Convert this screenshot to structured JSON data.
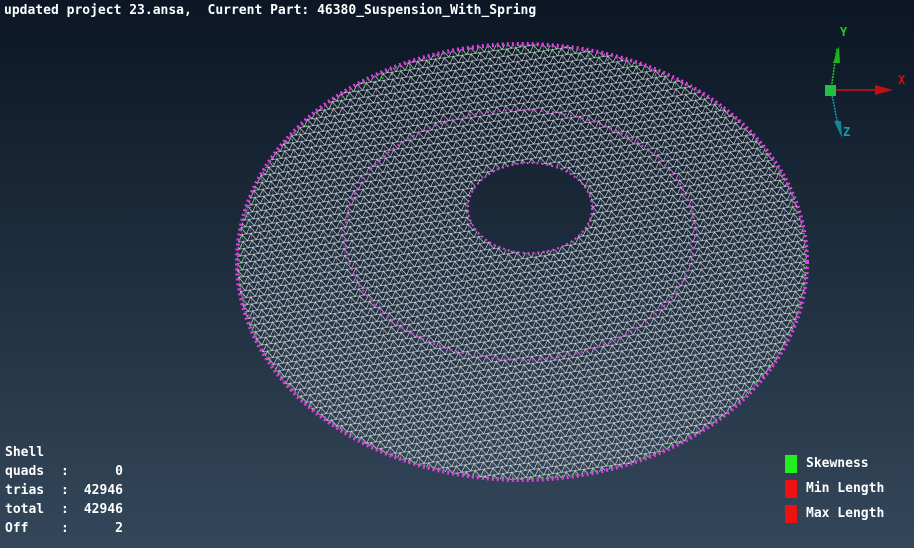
{
  "header": {
    "title": "updated project 23.ansa,  Current Part: 46380_Suspension_With_Spring"
  },
  "axes": {
    "x": "X",
    "y": "Y",
    "z": "Z",
    "x_color": "#d01010",
    "y_color": "#20d020",
    "z_color": "#10a0a8"
  },
  "stats": {
    "heading": "Shell",
    "rows": [
      {
        "label": "quads",
        "sep": ":",
        "value": "0"
      },
      {
        "label": "trias",
        "sep": ":",
        "value": "42946"
      },
      {
        "label": "total",
        "sep": ":",
        "value": "42946"
      },
      {
        "label": "Off",
        "sep": ":",
        "value": "2"
      }
    ]
  },
  "legend": [
    {
      "label": "Skewness",
      "color": "#22ee22"
    },
    {
      "label": "Min Length",
      "color": "#ee1111"
    },
    {
      "label": "Max Length",
      "color": "#ee1111"
    }
  ]
}
